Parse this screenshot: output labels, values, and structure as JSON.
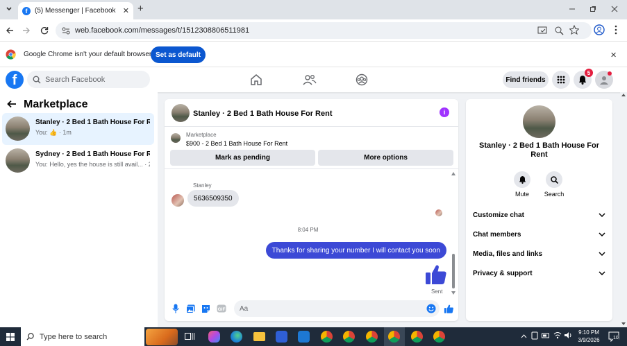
{
  "browser": {
    "tab_title": "(5) Messenger | Facebook",
    "url": "web.facebook.com/messages/t/1512308806511981",
    "banner_text": "Google Chrome isn't your default browser",
    "banner_button": "Set as default",
    "new_tab": "+",
    "close_glyph": "✕"
  },
  "fb_header": {
    "logo": "f",
    "search_placeholder": "Search Facebook",
    "find_friends": "Find friends",
    "notification_count": "5"
  },
  "left_panel": {
    "title": "Marketplace",
    "conversations": [
      {
        "name": "Stanley · 2 Bed 1 Bath House For R...",
        "snippet": "You: 👍 · 1m",
        "active": true
      },
      {
        "name": "Sydney · 2 Bed 1 Bath House For R...",
        "snippet": "You: Hello, yes the house is still avail... · 23h",
        "active": false
      }
    ]
  },
  "chat": {
    "title": "Stanley · 2 Bed 1 Bath House For Rent",
    "info_glyph": "i",
    "marketplace_label": "Marketplace",
    "listing": "$900 - 2 Bed 1 Bath House For Rent",
    "mark_pending": "Mark as pending",
    "more_options": "More options",
    "sender_name": "Stanley",
    "incoming_message": "5636509350",
    "timestamp": "8:04 PM",
    "outgoing_message": "Thanks for sharing your number I will contact you soon",
    "status": "Sent",
    "input_placeholder": "Aa"
  },
  "right_panel": {
    "title": "Stanley · 2 Bed 1 Bath House For Rent",
    "mute_label": "Mute",
    "search_label": "Search",
    "sections": [
      "Customize chat",
      "Chat members",
      "Media, files and links",
      "Privacy & support"
    ]
  },
  "taskbar": {
    "search_placeholder": "Type here to search",
    "time": "9:10 PM",
    "date": "3/9/2026",
    "notif_count": "10"
  },
  "colors": {
    "fb_blue": "#1877f2",
    "outgoing_bubble": "#3c49d6",
    "chrome_button": "#0b57d0",
    "badge_red": "#e41e3f",
    "info_purple": "#a033ff"
  }
}
